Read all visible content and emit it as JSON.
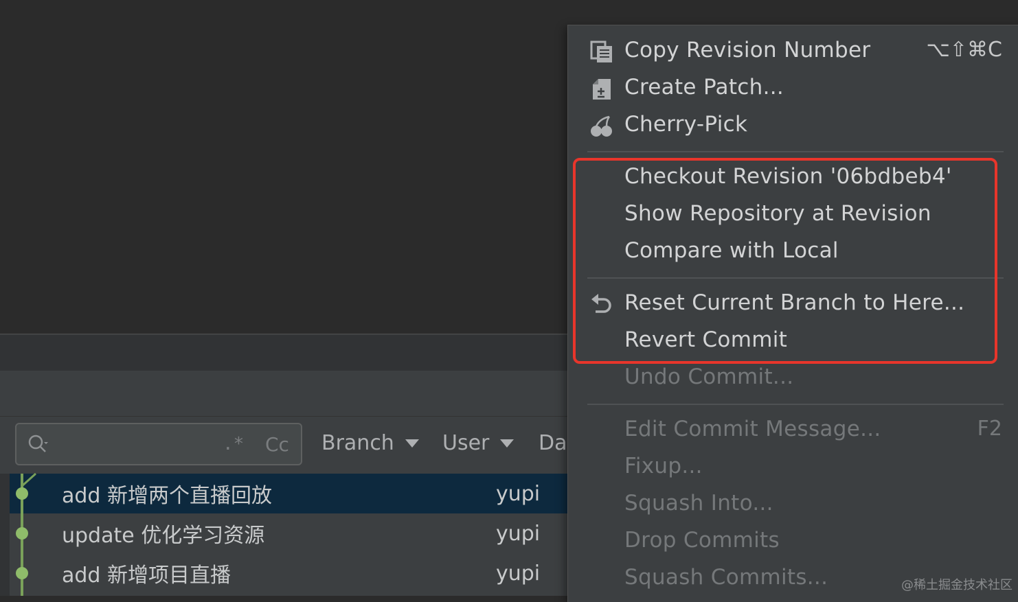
{
  "log": {
    "search": {
      "regex_label": ".*",
      "case_label": "Cc"
    },
    "filters": {
      "branch": "Branch",
      "user": "User",
      "date": "Da"
    },
    "commits": [
      {
        "message": "add 新增两个直播回放",
        "author": "yupi",
        "selected": true
      },
      {
        "message": "update 优化学习资源",
        "author": "yupi",
        "selected": false
      },
      {
        "message": "add 新增项目直播",
        "author": "yupi",
        "selected": false
      }
    ]
  },
  "context_menu": {
    "items": [
      {
        "label": "Copy Revision Number",
        "shortcut": "⌥⇧⌘C",
        "icon": "copy-icon",
        "enabled": true
      },
      {
        "label": "Create Patch...",
        "icon": "patch-icon",
        "enabled": true
      },
      {
        "label": "Cherry-Pick",
        "icon": "cherry-icon",
        "enabled": true
      },
      {
        "label": "Checkout Revision '06bdbeb4'",
        "enabled": true
      },
      {
        "label": "Show Repository at Revision",
        "enabled": true
      },
      {
        "label": "Compare with Local",
        "enabled": true
      },
      {
        "label": "Reset Current Branch to Here...",
        "icon": "undo-arrow-icon",
        "enabled": true
      },
      {
        "label": "Revert Commit",
        "enabled": true
      },
      {
        "label": "Undo Commit...",
        "enabled": false
      },
      {
        "label": "Edit Commit Message...",
        "shortcut": "F2",
        "enabled": false
      },
      {
        "label": "Fixup...",
        "enabled": false
      },
      {
        "label": "Squash Into...",
        "enabled": false
      },
      {
        "label": "Drop Commits",
        "enabled": false
      },
      {
        "label": "Squash Commits...",
        "enabled": false
      }
    ]
  },
  "annotation": {
    "highlight_color": "#e8352b"
  },
  "watermark": "@稀土掘金技术社区"
}
